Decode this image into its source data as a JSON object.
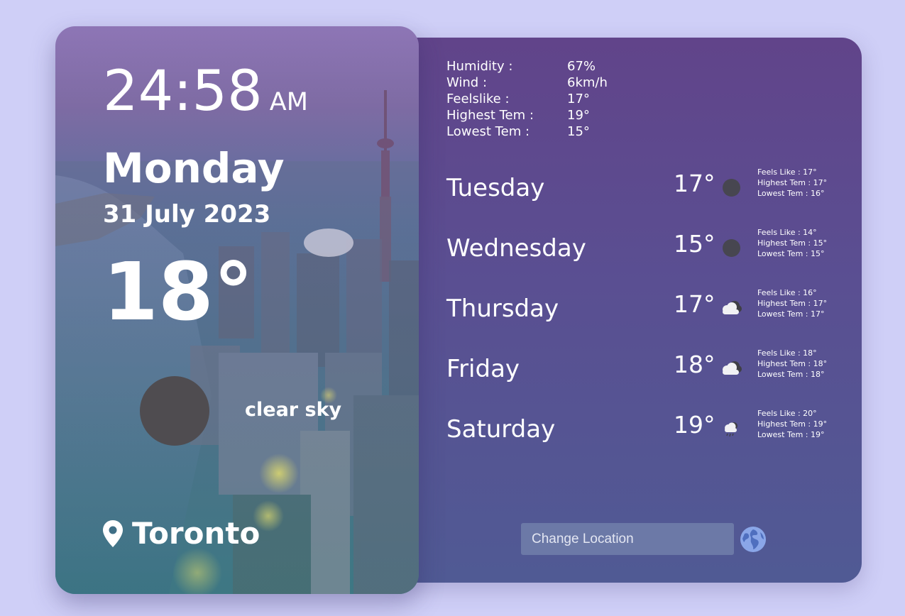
{
  "current": {
    "time": "24:58",
    "ampm": "AM",
    "day": "Monday",
    "date": "31 July 2023",
    "temperature": "18°",
    "condition": "clear sky",
    "location": "Toronto",
    "condition_icon": "dark-circle-weather-icon"
  },
  "details": [
    {
      "label": "Humidity :",
      "value": "67%"
    },
    {
      "label": "Wind :",
      "value": "6km/h"
    },
    {
      "label": "Feelslike :",
      "value": "17°"
    },
    {
      "label": "Highest Tem :",
      "value": "19°"
    },
    {
      "label": "Lowest Tem :",
      "value": "15°"
    }
  ],
  "forecast": [
    {
      "day": "Tuesday",
      "temp": "17°",
      "icon": "dark-circle-icon",
      "feels": "Feels Like : 17°",
      "high": "Highest Tem : 17°",
      "low": "Lowest Tem : 16°"
    },
    {
      "day": "Wednesday",
      "temp": "15°",
      "icon": "dark-circle-icon",
      "feels": "Feels Like : 14°",
      "high": "Highest Tem : 15°",
      "low": "Lowest Tem : 15°"
    },
    {
      "day": "Thursday",
      "temp": "17°",
      "icon": "cloudy-icon",
      "feels": "Feels Like : 16°",
      "high": "Highest Tem : 17°",
      "low": "Lowest Tem : 17°"
    },
    {
      "day": "Friday",
      "temp": "18°",
      "icon": "cloudy-icon",
      "feels": "Feels Like : 18°",
      "high": "Highest Tem : 18°",
      "low": "Lowest Tem : 18°"
    },
    {
      "day": "Saturday",
      "temp": "19°",
      "icon": "rain-cloud-icon",
      "feels": "Feels Like : 20°",
      "high": "Highest Tem : 19°",
      "low": "Lowest Tem : 19°"
    }
  ],
  "search": {
    "placeholder": "Change Location"
  },
  "colors": {
    "background": "#cfcff7",
    "panel_top": "#61448a",
    "panel_bottom": "#505a94",
    "input_bg": "#6c79a7",
    "globe": "#8aa6e8"
  }
}
